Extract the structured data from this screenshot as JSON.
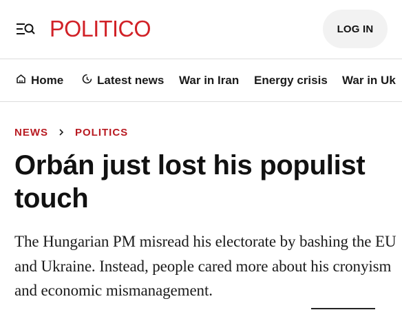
{
  "header": {
    "logo_text": "POLITICO",
    "login_label": "LOG IN",
    "brand_color": "#d12127",
    "menu_icon": "menu-search-icon"
  },
  "nav": {
    "items": [
      {
        "label": "Home",
        "icon": "home-icon"
      },
      {
        "label": "Latest news",
        "icon": "clock-icon"
      },
      {
        "label": "War in Iran"
      },
      {
        "label": "Energy crisis"
      },
      {
        "label": "War in Uk"
      }
    ]
  },
  "breadcrumb": {
    "items": [
      "NEWS",
      "POLITICS"
    ],
    "color": "#b81a21"
  },
  "article": {
    "headline": "Orbán just lost his populist touch",
    "dek": "The Hungarian PM misread his electorate by bashing the EU and Ukraine. Instead, people cared more about his cronyism and economic mismanagement."
  }
}
